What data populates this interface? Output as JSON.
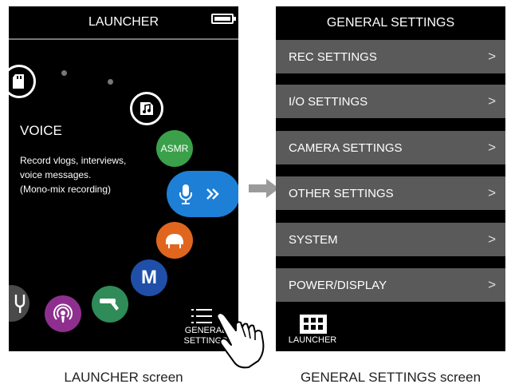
{
  "launcher": {
    "title": "LAUNCHER",
    "mode": {
      "title": "VOICE",
      "description_lines": [
        "Record vlogs, interviews,",
        "voice messages.",
        "(Mono-mix recording)"
      ]
    },
    "asmr_label": "ASMR",
    "m_label": "M",
    "general_settings_label_line1": "GENERAL",
    "general_settings_label_line2": "SETTINGS",
    "icons": [
      "sd-card-icon",
      "music-file-icon",
      "asmr-icon",
      "microphone-icon",
      "chevron-double-right-icon",
      "piano-icon",
      "m-icon",
      "handheld-mic-icon",
      "podcast-icon",
      "tuning-fork-icon",
      "list-menu-icon"
    ]
  },
  "general_settings": {
    "title": "GENERAL SETTINGS",
    "items": [
      {
        "label": "REC SETTINGS"
      },
      {
        "label": "I/O SETTINGS"
      },
      {
        "label": "CAMERA SETTINGS"
      },
      {
        "label": "OTHER SETTINGS"
      },
      {
        "label": "SYSTEM"
      },
      {
        "label": "POWER/DISPLAY"
      }
    ],
    "chevron": ">",
    "launcher_label": "LAUNCHER"
  },
  "captions": {
    "left": "LAUNCHER screen",
    "right": "GENERAL SETTINGS screen"
  },
  "colors": {
    "asmr": "#3aa14a",
    "voice": "#1e7fd6",
    "piano": "#e0661f",
    "m": "#1f4fa8",
    "mic": "#2f8b57",
    "podcast": "#8e2f8f",
    "menu_row": "#5a5a5a"
  }
}
